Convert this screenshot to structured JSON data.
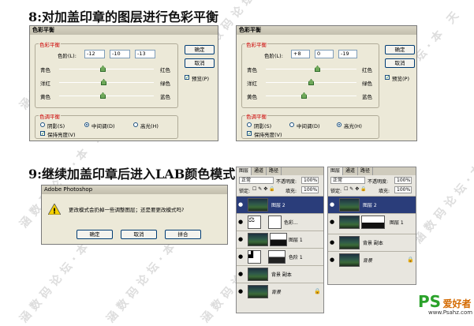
{
  "step8_title": "8:对加盖印章的图层进行色彩平衡",
  "step9_title": "9:继续加盖印章后进入LAB颜色模式",
  "watermark": "涵数码论坛·本 天",
  "color_balance_left": {
    "title": "色彩平衡",
    "group_balance": "色彩平衡",
    "levels_label": "色阶(L):",
    "levels": [
      "-12",
      "-10",
      "-13"
    ],
    "cyan": "青色",
    "red": "红色",
    "magenta": "洋红",
    "green": "绿色",
    "yellow": "黄色",
    "blue": "蓝色",
    "group_tone": "色调平衡",
    "shadows": "阴影(S)",
    "midtones": "中间调(D)",
    "highlights": "高光(H)",
    "preserve": "保持亮度(V)",
    "ok": "确定",
    "cancel": "取消",
    "preview": "预览(P)",
    "selected_tone": "midtones"
  },
  "color_balance_right": {
    "title": "色彩平衡",
    "group_balance": "色彩平衡",
    "levels_label": "色阶(L):",
    "levels": [
      "+8",
      "0",
      "-19"
    ],
    "cyan": "青色",
    "red": "红色",
    "magenta": "洋红",
    "green": "绿色",
    "yellow": "黄色",
    "blue": "蓝色",
    "group_tone": "色调平衡",
    "shadows": "阴影(S)",
    "midtones": "中间调(D)",
    "highlights": "高光(H)",
    "preserve": "保持亮度(V)",
    "ok": "确定",
    "cancel": "取消",
    "preview": "预览(P)",
    "selected_tone": "highlights"
  },
  "ps_alert": {
    "title": "Adobe Photoshop",
    "message": "更改模式会扔掉一些调整图层；还是要更改模式吗?",
    "ok": "确定",
    "cancel": "取消",
    "flatten": "拼合"
  },
  "layers_left": {
    "tabs": [
      "图层",
      "通道",
      "路径"
    ],
    "blend": "正常",
    "opacity_label": "不透明度:",
    "opacity": "100%",
    "lock_label": "锁定:",
    "fill_label": "填充:",
    "fill": "100%",
    "layers": [
      "图层 2",
      "色彩...",
      "图层 1",
      "色阶 1",
      "背景 副本",
      "背景"
    ]
  },
  "layers_right": {
    "tabs": [
      "图层",
      "通道",
      "路径"
    ],
    "blend": "正常",
    "opacity_label": "不透明度:",
    "opacity": "100%",
    "lock_label": "锁定:",
    "fill_label": "填充:",
    "fill": "100%",
    "layers": [
      "图层 2",
      "图层 1",
      "背景 副本",
      "背景"
    ]
  },
  "logo": {
    "ps": "PS",
    "name": "爱好者",
    "url": "www.Psahz.com"
  }
}
